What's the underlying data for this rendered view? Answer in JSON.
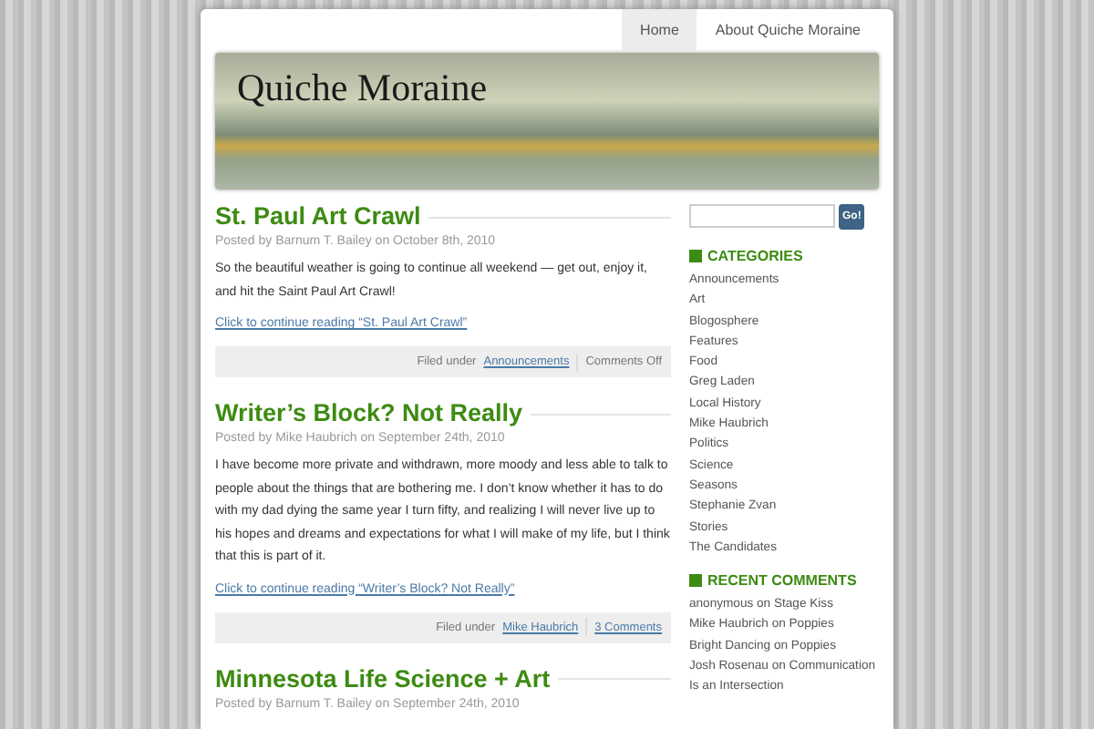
{
  "nav": [
    {
      "label": "Home",
      "selected": true
    },
    {
      "label": "About Quiche Moraine",
      "selected": false
    }
  ],
  "site_title": "Quiche Moraine",
  "posts": [
    {
      "title": "St. Paul Art Crawl",
      "byline": "Posted by Barnum T. Bailey on October 8th, 2010",
      "body": "So the beautiful weather is going to continue all weekend — get out, enjoy it, and hit the Saint Paul Art Crawl!",
      "more": "Click to continue reading “St. Paul Art Crawl”",
      "filed_label": "Filed under",
      "category": "Announcements",
      "comments": "Comments Off",
      "comments_linked": false
    },
    {
      "title": "Writer’s Block? Not Really",
      "byline": "Posted by Mike Haubrich on September 24th, 2010",
      "body": "I have become more private and withdrawn, more moody and less able to talk to people about the things that are bothering me. I don’t know whether it has to do with my dad dying the same year I turn fifty, and realizing I will never live up to his hopes and dreams and expectations for what I will make of my life, but I think that this is part of it.",
      "more": "Click to continue reading “Writer’s Block? Not Really”",
      "filed_label": "Filed under",
      "category": "Mike Haubrich",
      "comments": "3 Comments",
      "comments_linked": true
    },
    {
      "title": "Minnesota Life Science + Art",
      "byline": "Posted by Barnum T. Bailey on September 24th, 2010"
    }
  ],
  "search": {
    "button": "Go!"
  },
  "categories": {
    "heading": "CATEGORIES",
    "items": [
      "Announcements",
      "Art",
      "Blogosphere",
      "Features",
      "Food",
      "Greg Laden",
      "Local History",
      "Mike Haubrich",
      "Politics",
      "Science",
      "Seasons",
      "Stephanie Zvan",
      "Stories",
      "The Candidates"
    ]
  },
  "recent_comments": {
    "heading": "RECENT COMMENTS",
    "items": [
      "anonymous on Stage Kiss",
      "Mike Haubrich on Poppies",
      "Bright Dancing on Poppies",
      "Josh Rosenau on Communication Is an Intersection"
    ]
  }
}
